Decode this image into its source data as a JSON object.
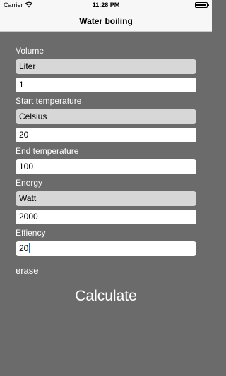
{
  "status_bar": {
    "carrier": "Carrier",
    "time": "11:28 PM",
    "icons": [
      "wifi-icon",
      "battery-icon"
    ]
  },
  "nav": {
    "title": "Water boiling"
  },
  "form": {
    "volume_label": "Volume",
    "volume_unit": "Liter",
    "volume_value": "1",
    "start_label": "Start temperature",
    "start_unit": "Celsius",
    "start_value": "20",
    "end_label": "End temperature",
    "end_value": "100",
    "energy_label": "Energy",
    "energy_unit": "Watt",
    "energy_value": "2000",
    "efficiency_label": "Effiency",
    "efficiency_value": "20"
  },
  "actions": {
    "erase": "erase",
    "calculate": "Calculate"
  },
  "colors": {
    "background": "#6b6b6b",
    "bar": "#f7f7f7",
    "select_field": "#d7d7d7",
    "text_field": "#ffffff",
    "caret": "#1565d8"
  }
}
